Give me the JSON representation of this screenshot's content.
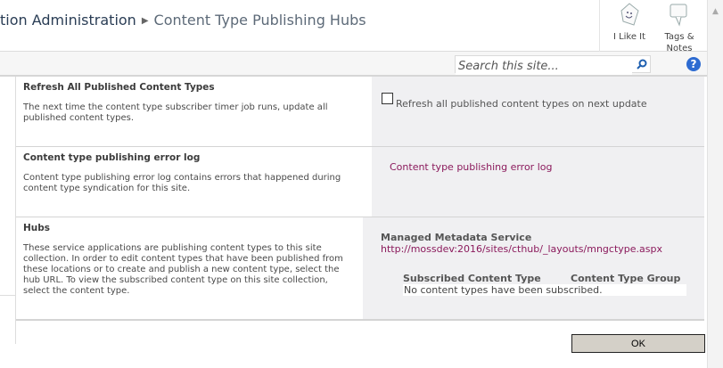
{
  "breadcrumb": {
    "parent": "tion Administration",
    "current": "Content Type Publishing Hubs"
  },
  "social": {
    "like": "I Like It",
    "tags": "Tags & Notes"
  },
  "search": {
    "placeholder": "Search this site..."
  },
  "help": "?",
  "sections": [
    {
      "title": "Refresh All Published Content Types",
      "desc": "The next time the content type subscriber timer job runs, update all published content types.",
      "checkbox_label": "Refresh all published content types on next update",
      "checked": false
    },
    {
      "title": "Content type publishing error log",
      "desc": "Content type publishing error log contains errors that happened during content type syndication for this site.",
      "link": "Content type publishing error log"
    },
    {
      "title": "Hubs",
      "desc": "These service applications are publishing content types to this site collection. In order to edit content types that have been published from these locations or to create and publish a new content type, select the hub URL.  To view the subscribed content type on this site collection, select the content type.",
      "service": "Managed Metadata Service",
      "url": "http://mossdev:2016/sites/cthub/_layouts/mngctype.aspx",
      "columns": [
        "Subscribed Content Type",
        "Content Type Group"
      ],
      "empty": "No content types have been subscribed."
    }
  ],
  "ok": "OK",
  "colors": {
    "link": "#8b1a5c",
    "panel": "#f0f0f2",
    "title": "#2a3d55"
  }
}
